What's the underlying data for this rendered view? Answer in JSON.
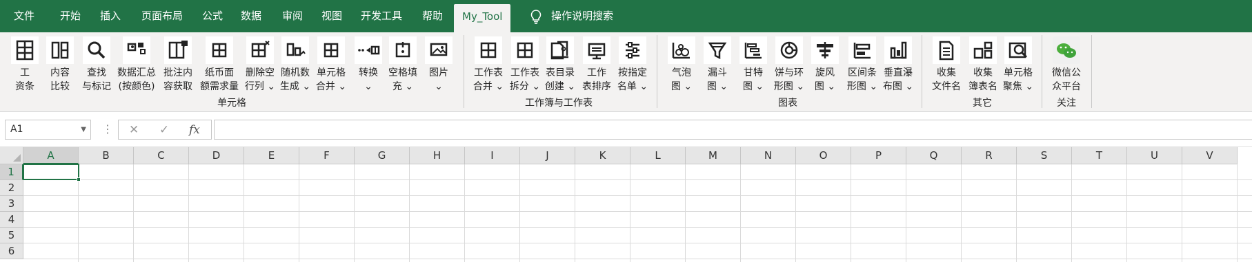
{
  "tabs": [
    "文件",
    "开始",
    "插入",
    "页面布局",
    "公式",
    "数据",
    "审阅",
    "视图",
    "开发工具",
    "帮助",
    "My_Tool"
  ],
  "tellme": "操作说明搜索",
  "groups": {
    "cells": {
      "label": "单元格",
      "buttons": [
        {
          "label": "工\n资条",
          "icon": "salary-slip-icon"
        },
        {
          "label": "内容\n比较",
          "icon": "compare-icon"
        },
        {
          "label": "查找\n与标记",
          "icon": "find-mark-icon"
        },
        {
          "label": "数据汇总\n(按颜色)",
          "icon": "summary-by-color-icon"
        },
        {
          "label": "批注内\n容获取",
          "icon": "comment-extract-icon"
        },
        {
          "label": "纸币面\n额需求量",
          "icon": "banknote-icon"
        },
        {
          "label": "删除空\n行列 ⌄",
          "icon": "delete-blank-icon"
        },
        {
          "label": "随机数\n生成 ⌄",
          "icon": "random-icon"
        },
        {
          "label": "单元格\n合并 ⌄",
          "icon": "merge-cells-icon"
        },
        {
          "label": "转换\n⌄",
          "icon": "convert-icon"
        },
        {
          "label": "空格填\n充 ⌄",
          "icon": "fill-blank-icon"
        },
        {
          "label": "图片\n⌄",
          "icon": "picture-icon"
        }
      ]
    },
    "workbook": {
      "label": "工作簿与工作表",
      "buttons": [
        {
          "label": "工作表\n合并 ⌄",
          "icon": "sheet-merge-icon"
        },
        {
          "label": "工作表\n拆分 ⌄",
          "icon": "sheet-split-icon"
        },
        {
          "label": "表目录\n创建 ⌄",
          "icon": "toc-icon"
        },
        {
          "label": "工作\n表排序",
          "icon": "sheet-sort-icon"
        },
        {
          "label": "按指定\n名单 ⌄",
          "icon": "name-list-icon"
        }
      ]
    },
    "charts": {
      "label": "图表",
      "buttons": [
        {
          "label": "气泡\n图 ⌄",
          "icon": "bubble-chart-icon"
        },
        {
          "label": "漏斗\n图 ⌄",
          "icon": "funnel-chart-icon"
        },
        {
          "label": "甘特\n图 ⌄",
          "icon": "gantt-chart-icon"
        },
        {
          "label": "饼与环\n形图 ⌄",
          "icon": "pie-chart-icon"
        },
        {
          "label": "旋风\n图 ⌄",
          "icon": "tornado-chart-icon"
        },
        {
          "label": "区间条\n形图 ⌄",
          "icon": "range-bar-icon"
        },
        {
          "label": "垂直瀑\n布图 ⌄",
          "icon": "waterfall-chart-icon"
        }
      ]
    },
    "other": {
      "label": "其它",
      "buttons": [
        {
          "label": "收集\n文件名",
          "icon": "collect-filenames-icon"
        },
        {
          "label": "收集\n簿表名",
          "icon": "collect-sheetnames-icon"
        },
        {
          "label": "单元格\n聚焦 ⌄",
          "icon": "cell-focus-icon"
        }
      ]
    },
    "follow": {
      "label": "关注",
      "buttons": [
        {
          "label": "微信公\n众平台",
          "icon": "wechat-icon"
        }
      ]
    }
  },
  "formula_bar": {
    "name_box": "A1",
    "cancel": "✕",
    "enter": "✓",
    "fx": "fx",
    "value": ""
  },
  "columns": [
    "A",
    "B",
    "C",
    "D",
    "E",
    "F",
    "G",
    "H",
    "I",
    "J",
    "K",
    "L",
    "M",
    "N",
    "O",
    "P",
    "Q",
    "R",
    "S",
    "T",
    "U",
    "V"
  ],
  "rows": [
    "1",
    "2",
    "3",
    "4",
    "5",
    "6"
  ],
  "selected_cell": "A1",
  "colors": {
    "ribbon_tab_bar": "#217346",
    "accent": "#217346"
  }
}
